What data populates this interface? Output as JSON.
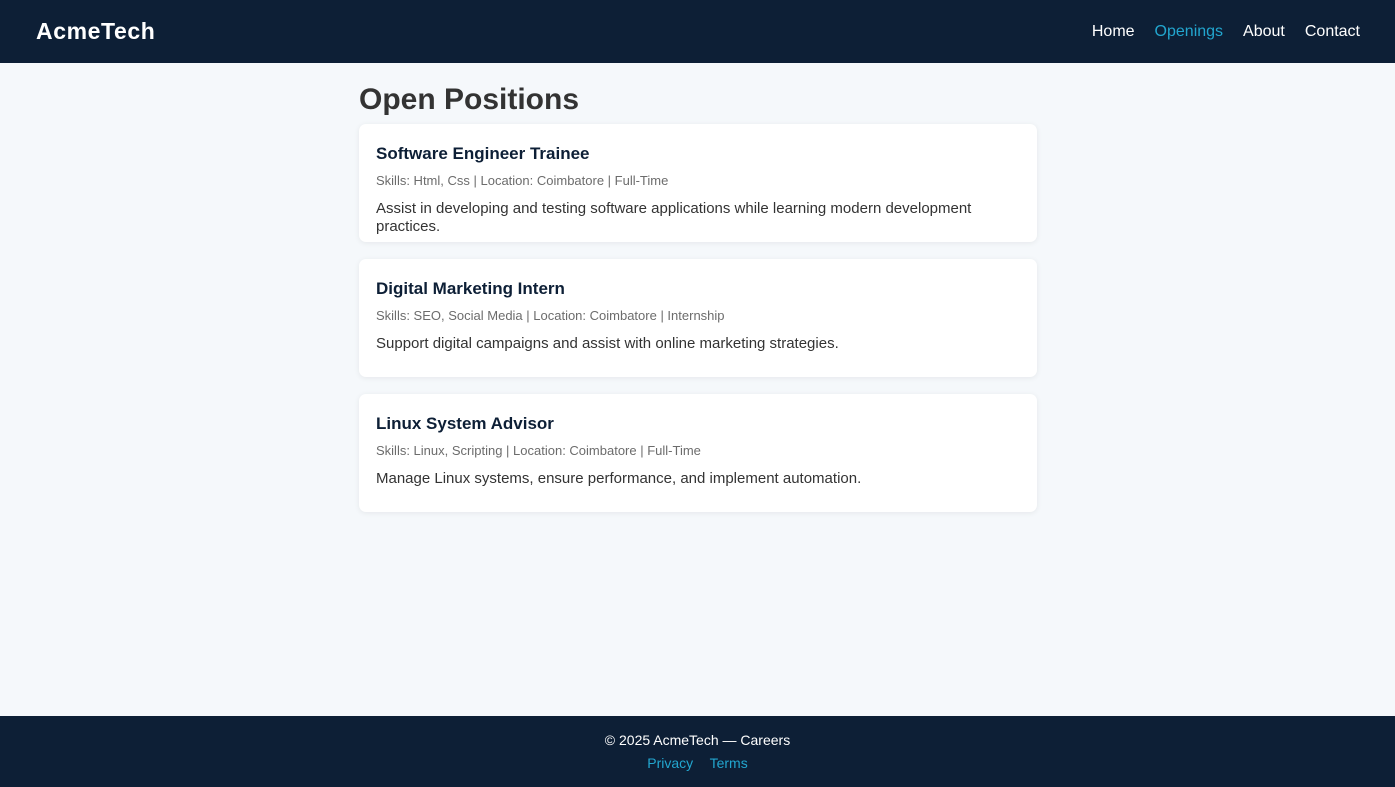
{
  "header": {
    "brand": "AcmeTech",
    "nav": [
      {
        "label": "Home",
        "active": false
      },
      {
        "label": "Openings",
        "active": true
      },
      {
        "label": "About",
        "active": false
      },
      {
        "label": "Contact",
        "active": false
      }
    ]
  },
  "main": {
    "title": "Open Positions",
    "jobs": [
      {
        "title": "Software Engineer Trainee",
        "meta": "Skills: Html, Css | Location: Coimbatore | Full-Time",
        "description": "Assist in developing and testing software applications while learning modern development practices."
      },
      {
        "title": "Digital Marketing Intern",
        "meta": "Skills: SEO, Social Media | Location: Coimbatore | Internship",
        "description": "Support digital campaigns and assist with online marketing strategies."
      },
      {
        "title": "Linux System Advisor",
        "meta": "Skills: Linux, Scripting | Location: Coimbatore | Full-Time",
        "description": "Manage Linux systems, ensure performance, and implement automation."
      }
    ]
  },
  "footer": {
    "copyright": "© 2025 AcmeTech — Careers",
    "links": [
      "Privacy",
      "Terms"
    ]
  },
  "colors": {
    "header_bg": "#0d1f36",
    "accent": "#22a6cf",
    "page_bg": "#f5f8fb"
  }
}
